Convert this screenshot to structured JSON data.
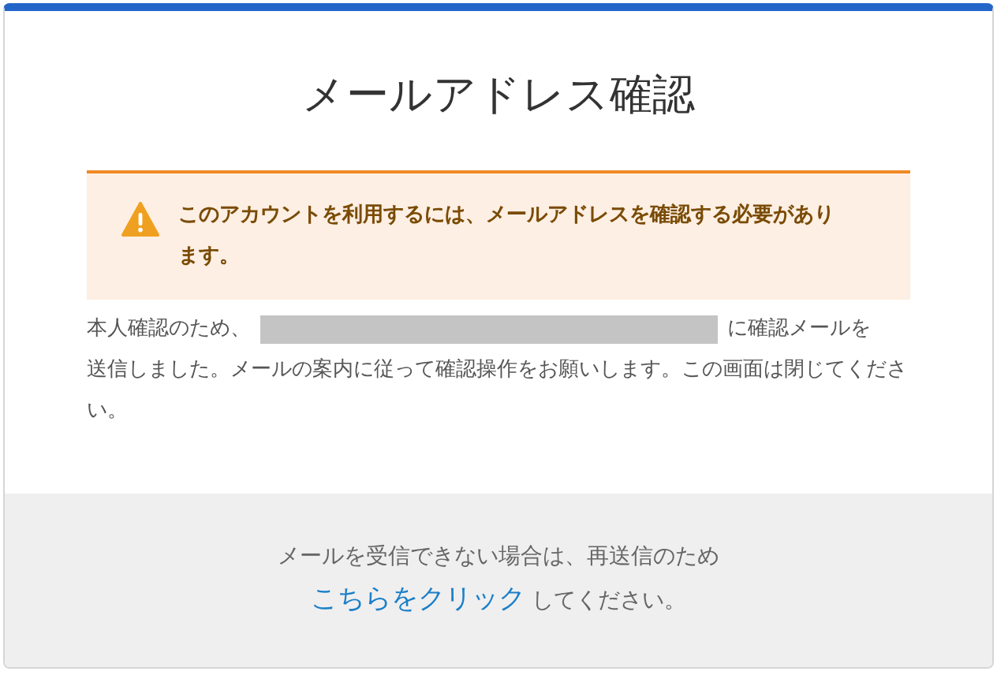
{
  "title": "メールアドレス確認",
  "alert": {
    "text": "このアカウントを利用するには、メールアドレスを確認する必要があります。"
  },
  "message": {
    "before": "本人確認のため、",
    "after": "に確認メールを",
    "rest": "送信しました。メールの案内に従って確認操作をお願いします。この画面は閉じてください。"
  },
  "footer": {
    "line": "メールを受信できない場合は、再送信のため",
    "link": "こちらをクリック",
    "after_link": "してください。"
  }
}
